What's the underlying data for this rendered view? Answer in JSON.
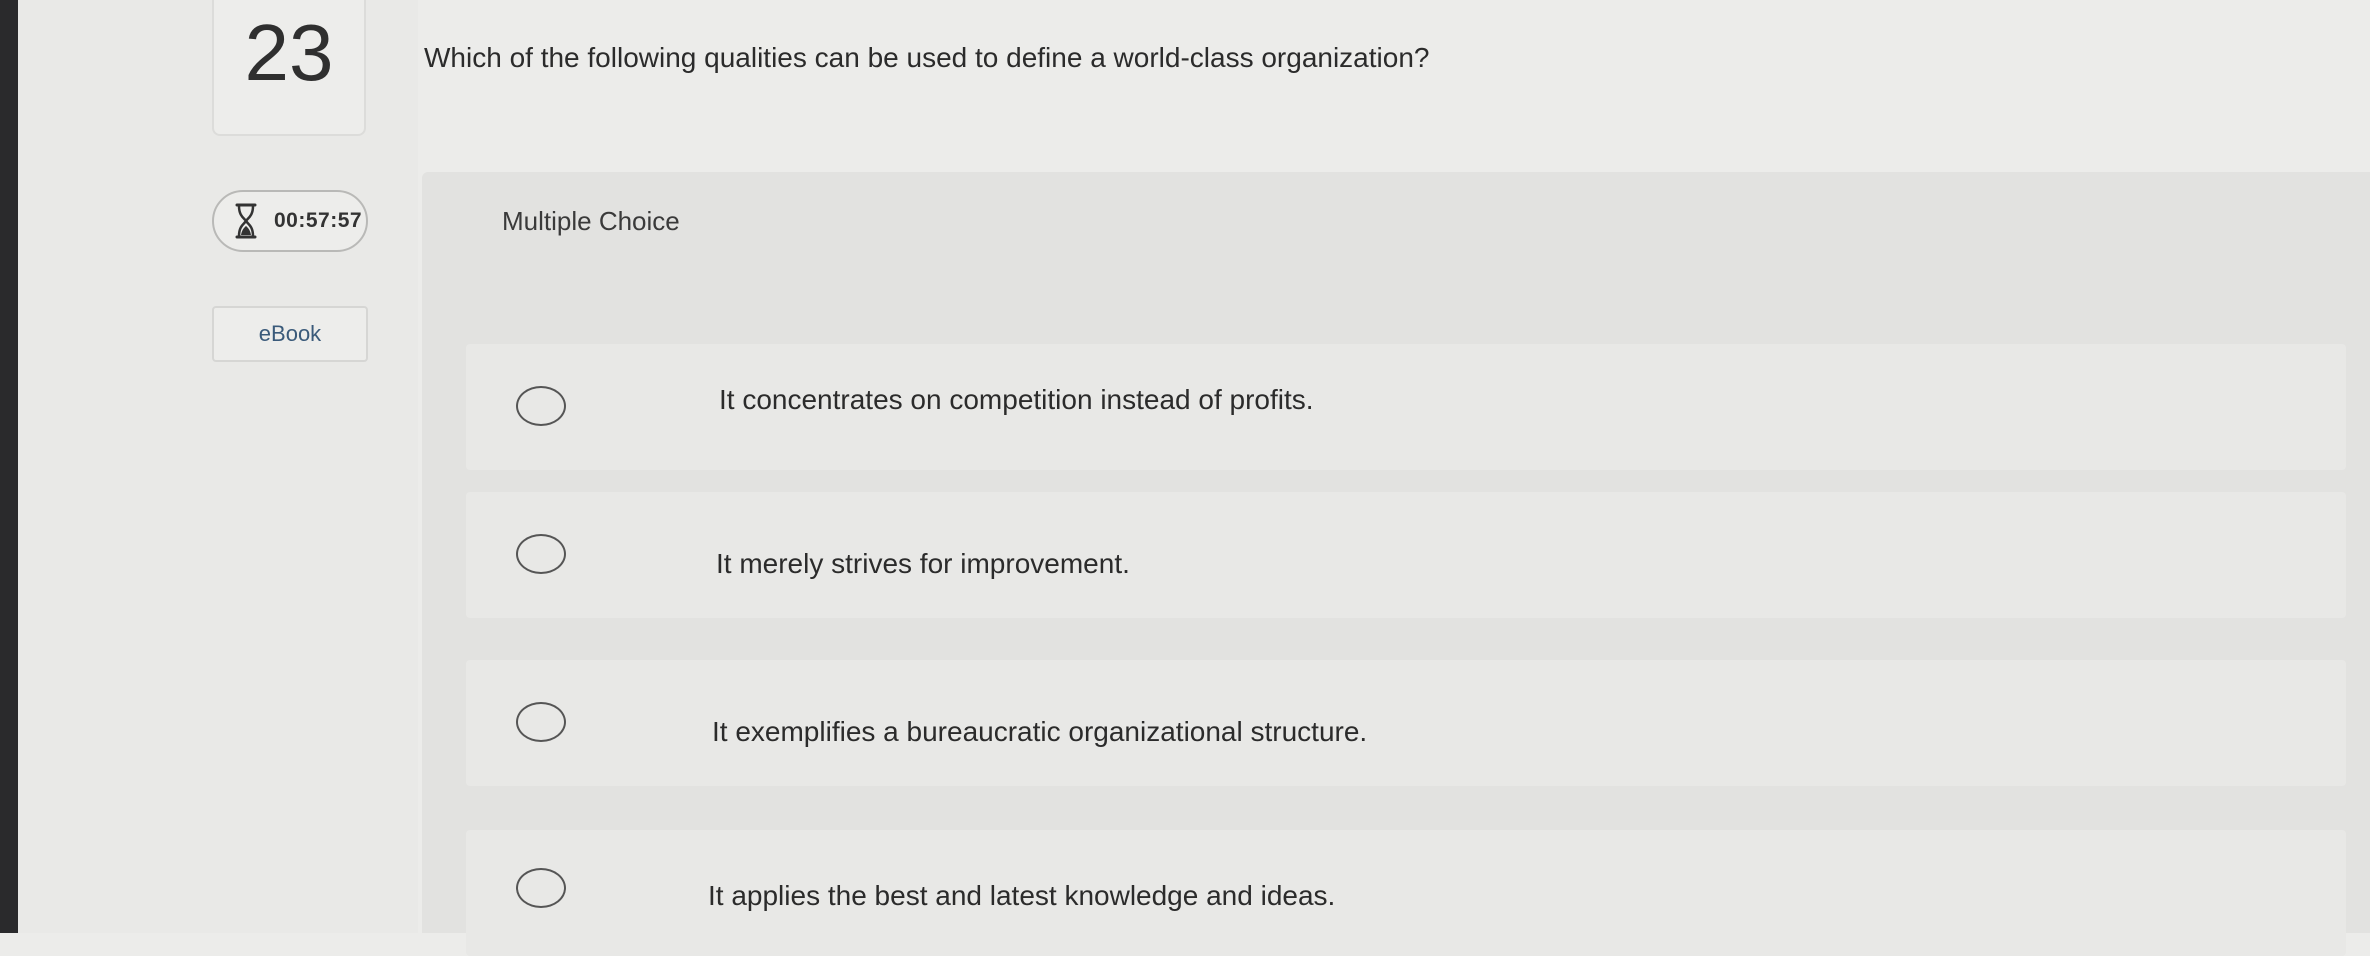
{
  "question": {
    "number": "23",
    "text": "Which of the following qualities can be used to define a world-class organization?"
  },
  "timer": {
    "icon": "hourglass-icon",
    "value": "00:57:57"
  },
  "ebook": {
    "label": "eBook"
  },
  "answer_type": "Multiple Choice",
  "options": [
    {
      "label": "It concentrates on competition instead of profits.",
      "selected": false
    },
    {
      "label": "It merely strives for improvement.",
      "selected": false
    },
    {
      "label": "It exemplifies a bureaucratic organizational structure.",
      "selected": false
    },
    {
      "label": "It applies the best and latest knowledge and ideas.",
      "selected": false
    }
  ],
  "colors": {
    "background": "#ececea",
    "panel": "#e2e2e0",
    "ebook_text": "#3a5a7a",
    "text": "#2b2b2b"
  }
}
